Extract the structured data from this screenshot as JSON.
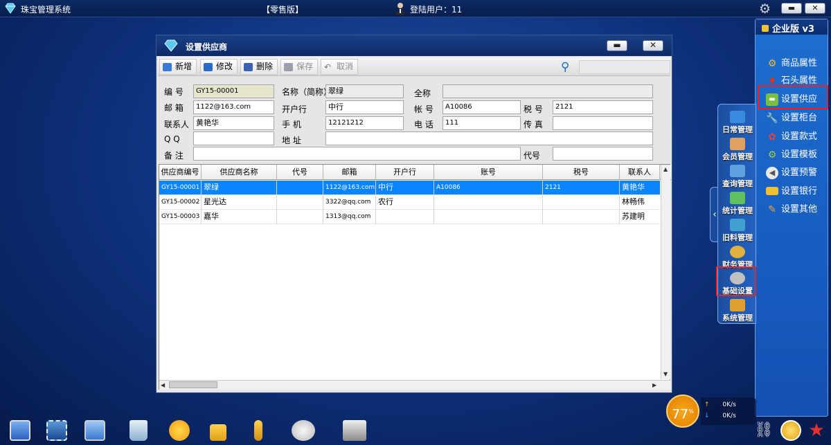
{
  "topbar": {
    "app_title": "珠宝管理系统",
    "edition": "【零售版】",
    "user_label": "登陆用户：11"
  },
  "right_panel": {
    "title": "企业版 v3",
    "items": [
      {
        "label": "商品属性",
        "icon": "gear-icon",
        "color": "#f0c030"
      },
      {
        "label": "石头属性",
        "icon": "gem-icon",
        "color": "#e03020"
      },
      {
        "label": "设置供应",
        "icon": "truck-icon",
        "color": "#7ac040"
      },
      {
        "label": "设置柜台",
        "icon": "wrench-icon",
        "color": "#c0c0c0"
      },
      {
        "label": "设置款式",
        "icon": "flower-icon",
        "color": "#e84040"
      },
      {
        "label": "设置模板",
        "icon": "gear-icon",
        "color": "#9ad040"
      },
      {
        "label": "设置预警",
        "icon": "speaker-icon",
        "color": "#f0f0f0"
      },
      {
        "label": "设置银行",
        "icon": "card-icon",
        "color": "#f0c030"
      },
      {
        "label": "设置其他",
        "icon": "edit-icon",
        "color": "#f0a030"
      }
    ]
  },
  "dock": {
    "items": [
      {
        "label": "日常管理",
        "icon": "daily-icon",
        "color": "#3a8ae0"
      },
      {
        "label": "会员管理",
        "icon": "member-icon",
        "color": "#e0a060"
      },
      {
        "label": "查询管理",
        "icon": "search-doc-icon",
        "color": "#60a0e0"
      },
      {
        "label": "统计管理",
        "icon": "stats-icon",
        "color": "#60c060"
      },
      {
        "label": "旧料管理",
        "icon": "material-icon",
        "color": "#40a0d0"
      },
      {
        "label": "财务管理",
        "icon": "money-icon",
        "color": "#e0b040"
      },
      {
        "label": "基础设置",
        "icon": "gear-icon",
        "color": "#c0c0c0"
      },
      {
        "label": "系统管理",
        "icon": "tools-icon",
        "color": "#e0a030"
      }
    ]
  },
  "window": {
    "title": "设置供应商",
    "toolbar": {
      "add": "新增",
      "edit": "修改",
      "delete": "删除",
      "save": "保存",
      "cancel": "取消"
    },
    "form": {
      "code_label": "编  号",
      "code_value": "GY15-00001",
      "name_label": "名称（简称）",
      "name_value": "翠绿",
      "fullname_label": "全称",
      "fullname_value": "",
      "email_label": "邮  箱",
      "email_value": "1122@163.com",
      "bank_label": "开户行",
      "bank_value": "中行",
      "account_label": "帐  号",
      "account_value": "A10086",
      "tax_label": "税  号",
      "tax_value": "2121",
      "contact_label": "联系人",
      "contact_value": "黄艳华",
      "mobile_label": "手  机",
      "mobile_value": "12121212",
      "phone_label": "电  话",
      "phone_value": "111",
      "fax_label": "传  真",
      "fax_value": "",
      "qq_label": "Q   Q",
      "qq_value": "",
      "address_label": "地  址",
      "address_value": "",
      "note_label": "备  注",
      "note_value": "",
      "alias_label": "代号",
      "alias_value": ""
    },
    "table": {
      "columns": [
        "供应商编号",
        "供应商名称",
        "代号",
        "邮箱",
        "开户行",
        "账号",
        "税号",
        "联系人"
      ],
      "rows": [
        [
          "GY15-00001",
          "翠绿",
          "",
          "1122@163.com",
          "中行",
          "A10086",
          "2121",
          "黄艳华"
        ],
        [
          "GY15-00002",
          "星光达",
          "",
          "3322@qq.com",
          "农行",
          "",
          "",
          "林畅伟"
        ],
        [
          "GY15-00003",
          "嘉华",
          "",
          "1313@qq.com",
          "",
          "",
          "",
          "苏建明"
        ]
      ]
    }
  },
  "status": {
    "meter": "77",
    "meter_unit": "%",
    "up_speed": "0K/s",
    "down_speed": "0K/s"
  },
  "taskbar": {
    "icons": [
      "monitor-icon",
      "picture-icon",
      "desktop-icon",
      "recycle-bin-icon",
      "weather-icon",
      "lock-icon",
      "key-icon",
      "volume-icon",
      "printer-icon"
    ],
    "right_icons": [
      "link-icon",
      "info-icon",
      "star-icon"
    ]
  }
}
